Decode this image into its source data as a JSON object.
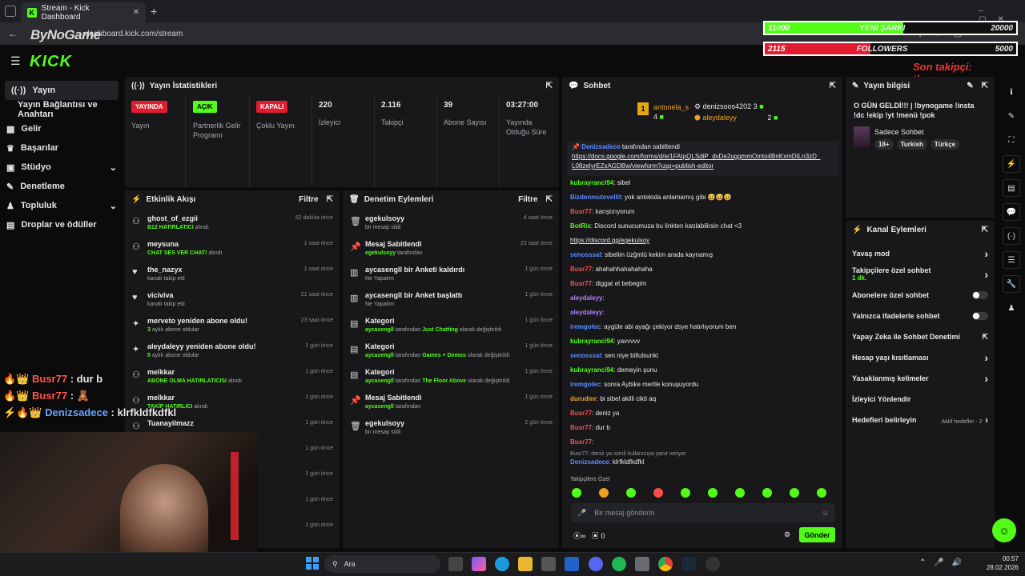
{
  "browser": {
    "tab_title": "Stream - Kick Dashboard",
    "url": "dashboard.kick.com/stream",
    "overlay_name": "ByNoGame"
  },
  "overlay": {
    "bar1": {
      "current": "11000",
      "label": "YENİ ŞARKI",
      "goal": "20000",
      "progress": 0.55,
      "color": "#53fc18"
    },
    "bar2": {
      "current": "2115",
      "label": "FOLLOWERS",
      "goal": "5000",
      "progress": 0.42,
      "color": "#e11d2f"
    },
    "last_follow": "Son takipçi: the_nazyx"
  },
  "kick": {
    "logo": "KICK"
  },
  "sidebar": {
    "items": [
      {
        "label": "Yayın",
        "icon": "broadcast-icon"
      },
      {
        "label": "Yayın Bağlantısı ve Anahtarı",
        "icon": ""
      },
      {
        "label": "Gelir",
        "icon": "revenue-icon"
      },
      {
        "label": "Başarılar",
        "icon": "trophy-icon"
      },
      {
        "label": "Stüdyo",
        "icon": "studio-icon"
      },
      {
        "label": "Denetleme",
        "icon": "moderation-icon"
      },
      {
        "label": "Topluluk",
        "icon": "community-icon"
      },
      {
        "label": "Droplar ve ödüller",
        "icon": "drops-icon"
      }
    ]
  },
  "stats": {
    "title": "Yayın İstatistikleri",
    "items": [
      {
        "badge": "YAYINDA",
        "label": "Yayın"
      },
      {
        "badge": "AÇIK",
        "label": "Partnerlik Gelir Programı"
      },
      {
        "badge": "KAPALI",
        "label": "Çoklu Yayın"
      },
      {
        "value": "220",
        "label": "İzleyici"
      },
      {
        "value": "2.116",
        "label": "Takipçi"
      },
      {
        "value": "39",
        "label": "Abone Sayısı"
      },
      {
        "value": "03:27:00",
        "label": "Yayında Olduğu Süre"
      }
    ]
  },
  "activity": {
    "title": "Etkinlik Akışı",
    "filter": "Filtre",
    "rows": [
      {
        "name": "ghost_of_ezgii",
        "detail_green": "B12 HATIRLATICI",
        "detail": "alındı",
        "time": "52 dakika önce"
      },
      {
        "name": "meysuna",
        "detail_green": "CHAT SES VER CHAT!",
        "detail": "alındı",
        "time": "1 saat önce"
      },
      {
        "name": "the_nazyx",
        "detail_green": "",
        "detail": "kanalı takip etti",
        "time": "1 saat önce"
      },
      {
        "name": "viciviva",
        "detail_green": "",
        "detail": "kanalı takip etti",
        "time": "21 saat önce"
      },
      {
        "name": "merveto yeniden abone oldu!",
        "detail_green": "3",
        "detail": "aylık abone oldular",
        "time": "23 saat önce"
      },
      {
        "name": "aleydaleyy yeniden abone oldu!",
        "detail_green": "5",
        "detail": "aylık abone oldular",
        "time": "1 gün önce"
      },
      {
        "name": "melkkar",
        "detail_green": "ABONE OLMA HATIRLATICISI",
        "detail": "alındı",
        "time": "1 gün önce"
      },
      {
        "name": "melkkar",
        "detail_green": "TAKİP HATIRLICI",
        "detail": "alındı",
        "time": "1 gün önce"
      },
      {
        "name": "Tuanayilmazz",
        "detail_green": "",
        "detail": "",
        "time": "1 gün önce"
      },
      {
        "name": "",
        "detail_green": "",
        "detail": "",
        "time": "1 gün önce"
      },
      {
        "name": "",
        "detail_green": "",
        "detail": "",
        "time": "1 gün önce"
      },
      {
        "name": "",
        "detail_green": "",
        "detail": "",
        "time": "1 gün önce"
      },
      {
        "name": "",
        "detail_green": "",
        "detail": "",
        "time": "1 gün önce"
      }
    ]
  },
  "mod": {
    "title": "Denetim Eylemleri",
    "filter": "Filtre",
    "rows": [
      {
        "icon": "trash-icon",
        "title": "egekulsoyy",
        "p1": "",
        "mid": "bir mesajı sildi",
        "p2": "",
        "end": "",
        "time": "4 saat önce"
      },
      {
        "icon": "pin-icon",
        "title": "Mesaj Sabitlendi",
        "p1": "egekulsoyy",
        "mid": " tarafından",
        "p2": "",
        "end": "",
        "time": "23 saat önce"
      },
      {
        "icon": "poll-icon",
        "title": "aycasengll bir Anketi kaldırdı",
        "p1": "",
        "mid": "Ne Yapalım",
        "p2": "",
        "end": "",
        "time": "1 gün önce"
      },
      {
        "icon": "poll-icon",
        "title": "aycasengll bir Anket başlattı",
        "p1": "",
        "mid": "Ne Yapalım",
        "p2": "",
        "end": "",
        "time": "1 gün önce"
      },
      {
        "icon": "category-icon",
        "title": "Kategori",
        "p1": "aycasengll",
        "mid": " tarafından ",
        "p2": "Just Chatting",
        "end": " olarak değiştirildi",
        "time": "1 gün önce"
      },
      {
        "icon": "category-icon",
        "title": "Kategori",
        "p1": "aycasengll",
        "mid": " tarafından ",
        "p2": "Games + Demos",
        "end": " olarak değiştirildi",
        "time": "1 gün önce"
      },
      {
        "icon": "category-icon",
        "title": "Kategori",
        "p1": "aycasengll",
        "mid": " tarafından ",
        "p2": "The Floor Above",
        "end": " olarak değiştirildi",
        "time": "1 gün önce"
      },
      {
        "icon": "pin-icon",
        "title": "Mesaj Sabitlendi",
        "p1": "aycasengll",
        "mid": " tarafından",
        "p2": "",
        "end": "",
        "time": "1 gün önce"
      },
      {
        "icon": "trash-icon",
        "title": "egekulsoyy",
        "p1": "",
        "mid": "bir mesajı sildi",
        "p2": "",
        "end": "",
        "time": "2 gün önce"
      }
    ]
  },
  "chat": {
    "title": "Sohbet",
    "top": [
      {
        "name": "antonela_s",
        "count": "4"
      },
      {
        "name": "denizsoos4202",
        "count": "3"
      },
      {
        "name": "aleydaleyy",
        "count": "2"
      }
    ],
    "pinned_by": "Denizsadece",
    "pinned_suffix": "tarafından sabitlendi",
    "pinned_link": "https://docs.google.com/forms/d/e/1FAIpQLSdiP_dvDe2uggmmOmto4BnKxmDILn3zD_L08zelyrEZsAGDBw/viewform?usp=publish-editor",
    "messages": [
      {
        "user": "kubrayranci94",
        "cls": "ugr",
        "text": ": sibel"
      },
      {
        "user": "Bizdenmutevellit",
        "cls": "ubl",
        "text": ": yok anteloda anlamamış gibi 😅😅😅"
      },
      {
        "user": "Busr77",
        "cls": "ure",
        "text": ": karıştırıyorum"
      },
      {
        "user": "BotRix",
        "cls": "ugr",
        "text": ": Discord sunucumuza bu linkten katılabilirsin chat <3"
      },
      {
        "user": "",
        "cls": "",
        "text": "https://discord.gg/egekulsoy"
      },
      {
        "user": "senosssal",
        "cls": "ubl",
        "text": ": sibelim üzğmlü kekim arada kaynamış"
      },
      {
        "user": "Busr77",
        "cls": "ure",
        "text": ": ahahahhahahahaha"
      },
      {
        "user": "Busr77",
        "cls": "ure",
        "text": ": diggat et bebegim"
      },
      {
        "user": "aleydaleyy",
        "cls": "upu",
        "text": ":"
      },
      {
        "user": "aleydaleyy",
        "cls": "upu",
        "text": ":"
      },
      {
        "user": "iremgolec",
        "cls": "ubl",
        "text": ": aygüle abi ayağı çekiyor dsye hatırlıyorum ben"
      },
      {
        "user": "kubrayranci94",
        "cls": "ugr",
        "text": ": yavvvvv"
      },
      {
        "user": "senosssal",
        "cls": "ubl",
        "text": ": sen niye billulsunki"
      },
      {
        "user": "kubrayranci94",
        "cls": "ugr",
        "text": ": demeyin şunu"
      },
      {
        "user": "iremgolec",
        "cls": "ubl",
        "text": ": sonra Aybike mertle konuşuyordu"
      },
      {
        "user": "durudmr",
        "cls": "uor",
        "text": ": bi sibel akilli cikti aq"
      },
      {
        "user": "Busr77",
        "cls": "ure",
        "text": ": deniz ya"
      },
      {
        "user": "Busr77",
        "cls": "ure",
        "text": ": dur b"
      },
      {
        "user": "Busr77",
        "cls": "ure",
        "text": ":"
      }
    ],
    "reply_hint": "Busr77: deniz ya isimli kullanıcıya yanıt veriyor",
    "last_user": "Denizsadece",
    "last_text": ": klrfkldfkdfkl",
    "emote_label": "Takipçilere Özel",
    "input_placeholder": "Bir mesaj gönderin",
    "points": "0",
    "send": "Gönder"
  },
  "info": {
    "title": "Yayın bilgisi",
    "stream_title": "O GÜN GELDİ!!! | !bynogame !insta !dc !ekip !yt !menü !pok",
    "category": "Sadece Sohbet",
    "tags": [
      "18+",
      "Turkish",
      "Türkçe"
    ]
  },
  "actions": {
    "title": "Kanal Eylemleri",
    "rows": [
      {
        "label": "Yavaş mod",
        "sub": "",
        "control": "chevron"
      },
      {
        "label": "Takipçilere özel sohbet",
        "sub": "1 dk.",
        "control": "chevron"
      },
      {
        "label": "Abonelere özel sohbet",
        "sub": "",
        "control": "toggle"
      },
      {
        "label": "Yalnızca ifadelerle sohbet",
        "sub": "",
        "control": "toggle"
      },
      {
        "label": "Yapay Zeka ile Sohbet Denetimi",
        "sub": "",
        "control": "external"
      },
      {
        "label": "Hesap yaşı kısıtlaması",
        "sub": "",
        "control": "chevron"
      },
      {
        "label": "Yasaklanmış kelimeler",
        "sub": "",
        "control": "chevron"
      },
      {
        "label": "İzleyici Yönlendir",
        "sub": "",
        "control": ""
      },
      {
        "label": "Hedefleri belirleyin",
        "sub": "",
        "control": "goal"
      }
    ],
    "goal_text": "Aktif hedefler - 2"
  },
  "overlay_chat": [
    {
      "user": "Busr77",
      "text": " : dur b",
      "color": "#ff5a4f"
    },
    {
      "user": "Busr77",
      "text": " :",
      "color": "#ff5a4f"
    },
    {
      "user": "Denizsadece",
      "text": " : klrfkldfkdfkl",
      "color": "#6aa8ff"
    }
  ],
  "taskbar": {
    "search": "Ara",
    "time": "00:57",
    "date": "28.02.2026"
  }
}
